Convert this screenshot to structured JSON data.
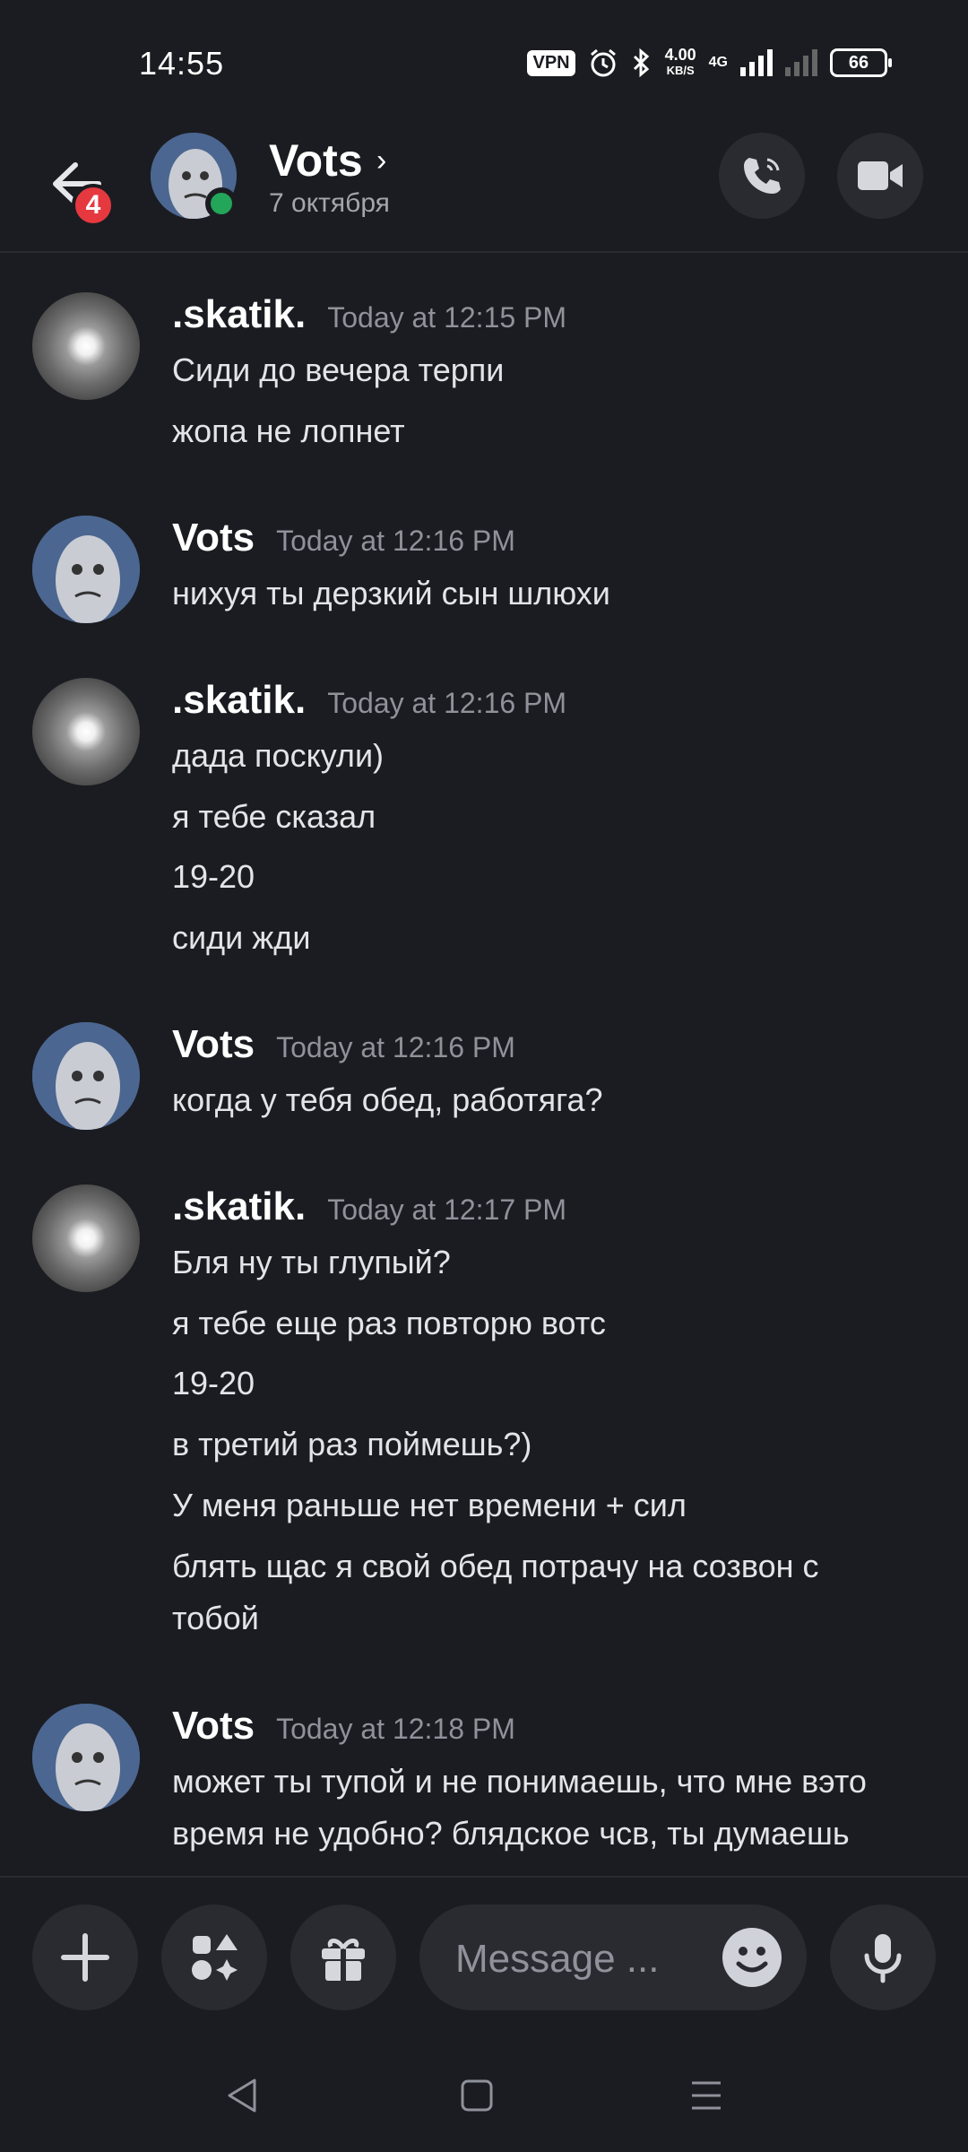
{
  "status": {
    "time": "14:55",
    "vpn": "VPN",
    "net_speed": "4.00",
    "net_unit": "KB/S",
    "network": "4G",
    "battery": "66"
  },
  "header": {
    "title": "Vots",
    "subtitle": "7 октября",
    "back_badge": "4"
  },
  "messages": [
    {
      "author": ".skatik.",
      "time": "Today at 12:15 PM",
      "avatar": "moon-avatar",
      "lines": [
        "Сиди до вечера терпи",
        "жопа не лопнет"
      ]
    },
    {
      "author": "Vots",
      "time": "Today at 12:16 PM",
      "avatar": "wojak-avatar",
      "lines": [
        "нихуя ты дерзкий сын шлюхи"
      ]
    },
    {
      "author": ".skatik.",
      "time": "Today at 12:16 PM",
      "avatar": "moon-avatar",
      "lines": [
        "дада поскули)",
        "я тебе сказал",
        "19-20",
        "сиди жди"
      ]
    },
    {
      "author": "Vots",
      "time": "Today at 12:16 PM",
      "avatar": "wojak-avatar",
      "lines": [
        "когда у тебя обед, работяга?"
      ]
    },
    {
      "author": ".skatik.",
      "time": "Today at 12:17 PM",
      "avatar": "moon-avatar",
      "lines": [
        "Бля ну ты глупый?",
        "я тебе еще раз повторю вотс",
        "19-20",
        "в третий раз поймешь?)",
        "У меня раньше нет времени + сил",
        "блять щас я свой обед потрачу на созвон с",
        "тобой"
      ]
    },
    {
      "author": "Vots",
      "time": "Today at 12:18 PM",
      "avatar": "wojak-avatar",
      "lines": [
        "может ты тупой и не понимаешь, что мне вэто",
        "время не удобно? блядское чсв, ты думаешь"
      ]
    }
  ],
  "composer": {
    "placeholder": "Message ..."
  },
  "colors": {
    "background": "#1b1c21",
    "surface": "#2a2b31",
    "online": "#23a55a",
    "badge": "#e5393f"
  }
}
